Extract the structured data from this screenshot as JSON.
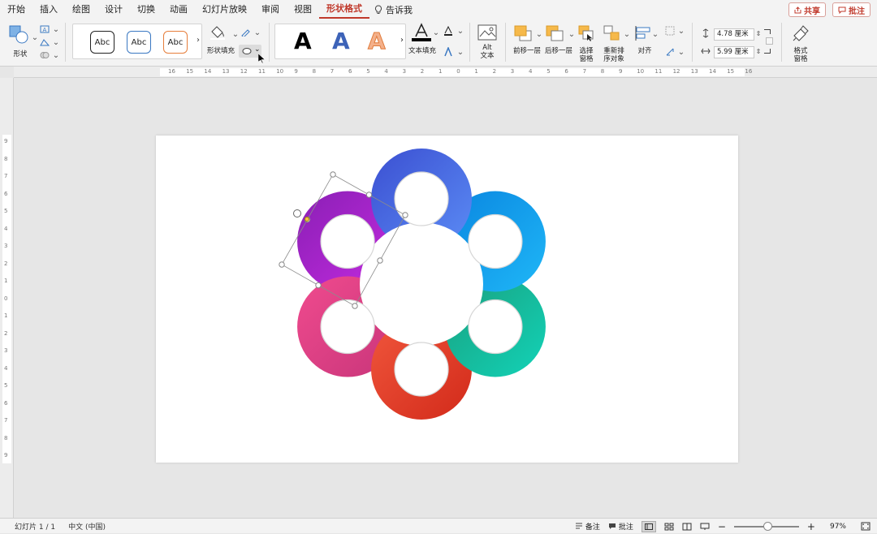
{
  "menu": {
    "tabs": [
      "开始",
      "插入",
      "绘图",
      "设计",
      "切换",
      "动画",
      "幻灯片放映",
      "审阅",
      "视图",
      "形状格式"
    ],
    "active_tab": "形状格式",
    "tell_me": "告诉我",
    "share": "共享",
    "comments": "批注"
  },
  "ribbon": {
    "shape_label": "形状",
    "style_samples": [
      "Abc",
      "Abc",
      "Abc"
    ],
    "shape_fill_label": "形状填充",
    "wordart_sample": "A",
    "text_fill_label": "文本填充",
    "alt_text_label_1": "Alt",
    "alt_text_label_2": "文本",
    "bring_forward": "前移一层",
    "send_backward": "后移一层",
    "selection_pane_1": "选择",
    "selection_pane_2": "窗格",
    "reorder_1": "重新排",
    "reorder_2": "序对象",
    "align": "对齐",
    "height_value": "4.78 厘米",
    "width_value": "5.99 厘米",
    "format_pane_1": "格式",
    "format_pane_2": "窗格"
  },
  "ruler": {
    "top_ticks": [
      "16",
      "15",
      "14",
      "13",
      "12",
      "11",
      "10",
      "9",
      "8",
      "7",
      "6",
      "5",
      "4",
      "3",
      "2",
      "1",
      "0",
      "1",
      "2",
      "3",
      "4",
      "5",
      "6",
      "7",
      "8",
      "9",
      "10",
      "11",
      "12",
      "13",
      "14",
      "15",
      "16"
    ],
    "left_ticks": [
      "9",
      "8",
      "7",
      "6",
      "5",
      "4",
      "3",
      "2",
      "1",
      "0",
      "1",
      "2",
      "3",
      "4",
      "5",
      "6",
      "7",
      "8",
      "9"
    ]
  },
  "diagram": {
    "segments": [
      {
        "name": "blue",
        "from": "#3b4fd1",
        "to": "#5b8cf5"
      },
      {
        "name": "sky",
        "from": "#0a86e0",
        "to": "#1fb7f7"
      },
      {
        "name": "teal",
        "from": "#1a9f7d",
        "to": "#12d3b8"
      },
      {
        "name": "red",
        "from": "#f0563c",
        "to": "#d22a1a"
      },
      {
        "name": "pink",
        "from": "#f04b8e",
        "to": "#c8357a"
      },
      {
        "name": "purple",
        "from": "#8a1fb5",
        "to": "#c42be0"
      }
    ]
  },
  "status": {
    "slide_info": "幻灯片 1 / 1",
    "language": "中文 (中国)",
    "notes": "备注",
    "comments": "批注",
    "zoom": "97%"
  }
}
